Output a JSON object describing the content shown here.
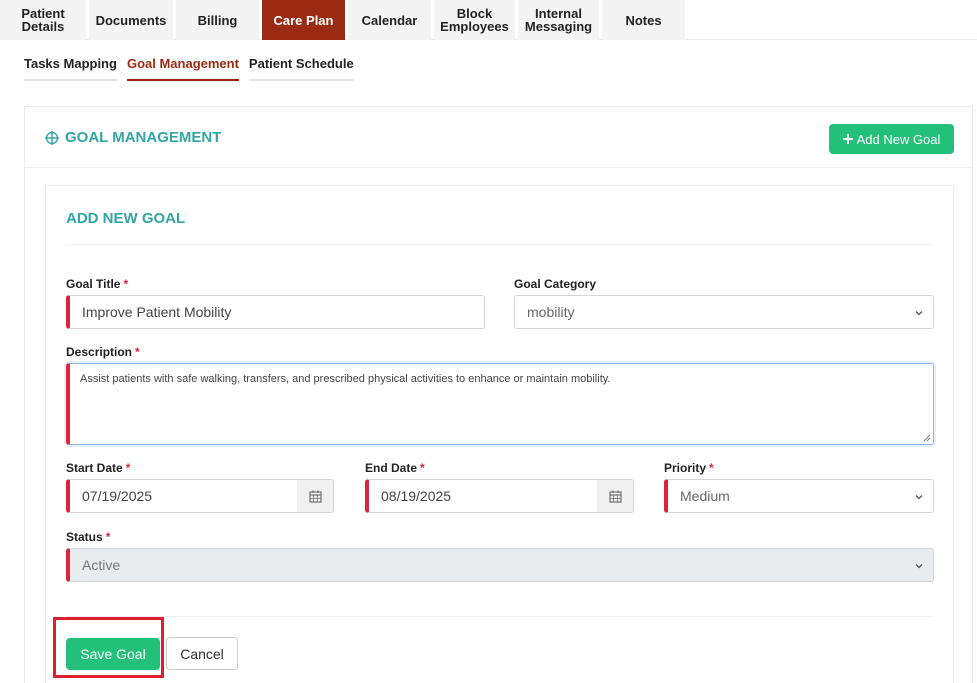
{
  "top_tabs": [
    {
      "line1": "Patient",
      "line2": "Details",
      "active": false
    },
    {
      "line1": "Documents",
      "line2": "",
      "active": false
    },
    {
      "line1": "Billing",
      "line2": "",
      "active": false
    },
    {
      "line1": "Care Plan",
      "line2": "",
      "active": true
    },
    {
      "line1": "Calendar",
      "line2": "",
      "active": false
    },
    {
      "line1": "Block",
      "line2": "Employees",
      "active": false
    },
    {
      "line1": "Internal",
      "line2": "Messaging",
      "active": false
    },
    {
      "line1": "Notes",
      "line2": "",
      "active": false
    }
  ],
  "sub_tabs": [
    {
      "label": "Tasks Mapping",
      "active": false
    },
    {
      "label": "Goal Management",
      "active": true
    },
    {
      "label": "Patient Schedule",
      "active": false
    }
  ],
  "goal_management": {
    "title": "GOAL MANAGEMENT",
    "title_icon": "crosshair-icon",
    "add_button_label": "Add New Goal",
    "add_button_icon": "plus-icon"
  },
  "form": {
    "title": "ADD NEW GOAL",
    "required_marker": "*",
    "goal_title": {
      "label": "Goal Title",
      "value": "Improve Patient Mobility"
    },
    "goal_category": {
      "label": "Goal Category",
      "value": "mobility"
    },
    "description": {
      "label": "Description",
      "value": "Assist patients with safe walking, transfers, and prescribed physical activities to enhance or maintain mobility."
    },
    "start_date": {
      "label": "Start Date",
      "value": "07/19/2025"
    },
    "end_date": {
      "label": "End Date",
      "value": "08/19/2025"
    },
    "priority": {
      "label": "Priority",
      "value": "Medium"
    },
    "status": {
      "label": "Status",
      "value": "Active"
    },
    "save_label": "Save Goal",
    "cancel_label": "Cancel"
  },
  "colors": {
    "brand_active_tab": "#9a2b12",
    "accent_teal": "#33a5a5",
    "button_green": "#22c079",
    "required_red": "#d9263a",
    "highlight_red": "#e01e2e"
  }
}
